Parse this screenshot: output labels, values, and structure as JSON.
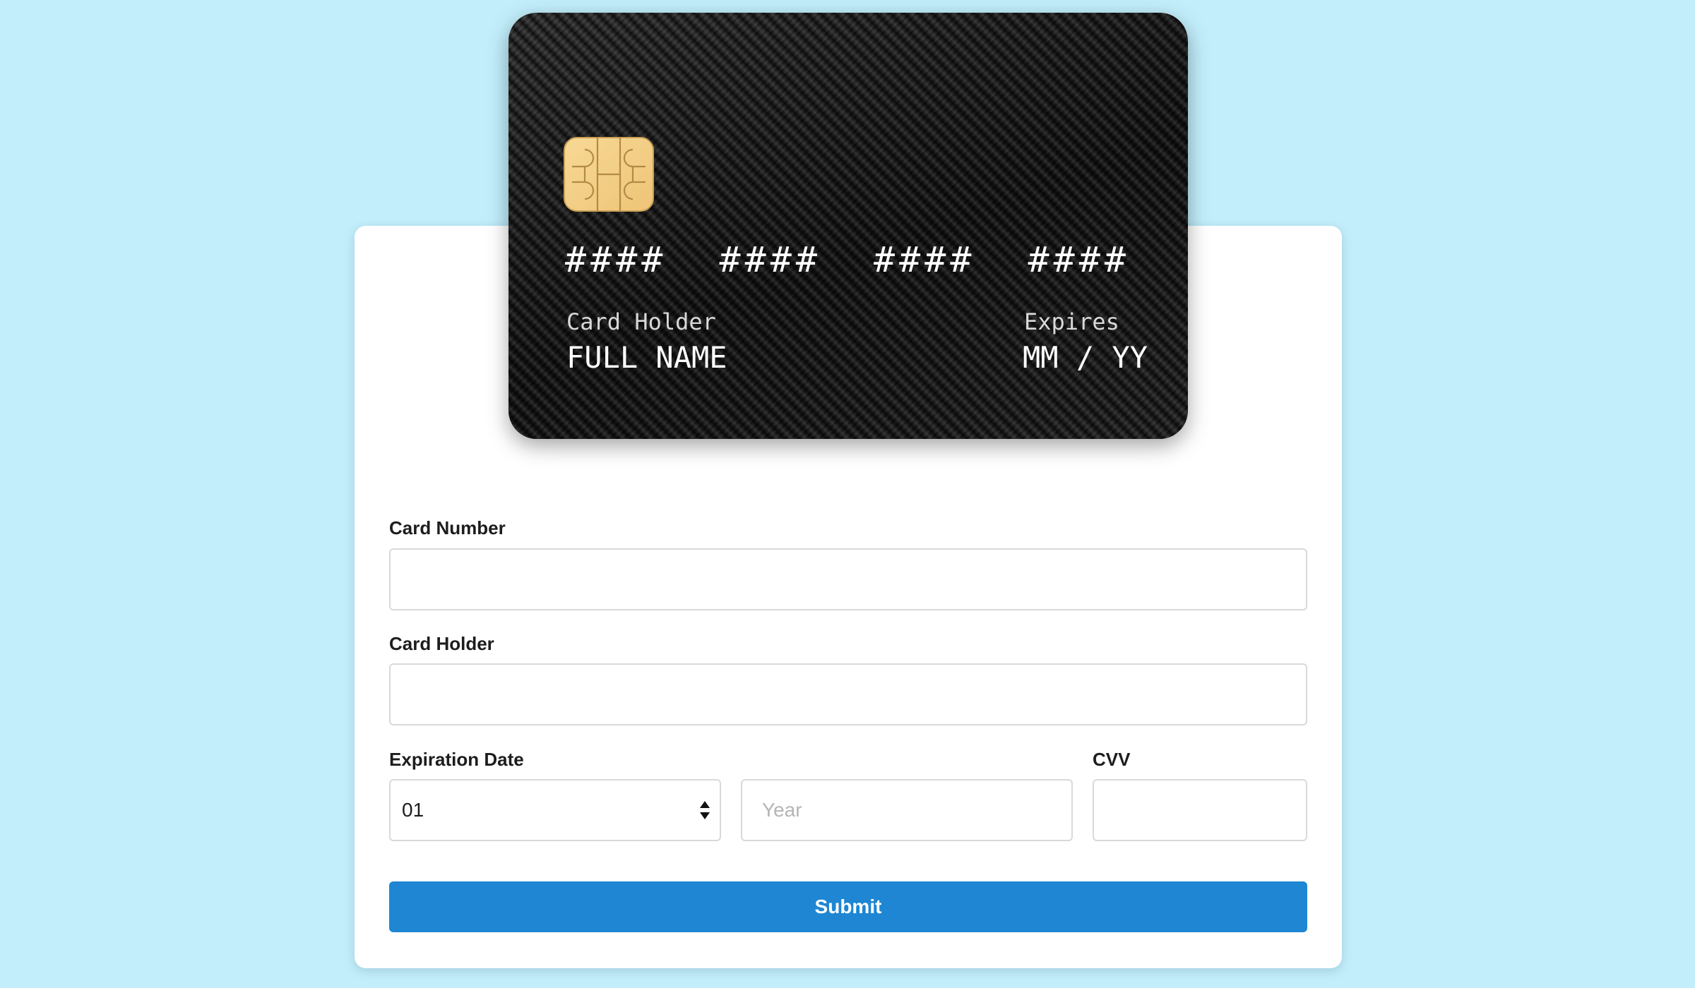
{
  "card_preview": {
    "number_groups": [
      "####",
      "####",
      "####",
      "####"
    ],
    "holder_caption": "Card Holder",
    "holder_value": "FULL NAME",
    "expires_caption": "Expires",
    "expires_value": "MM / YY"
  },
  "form": {
    "card_number": {
      "label": "Card Number",
      "value": "",
      "placeholder": ""
    },
    "card_holder": {
      "label": "Card Holder",
      "value": "",
      "placeholder": ""
    },
    "expiration": {
      "label": "Expiration Date",
      "month_selected": "01",
      "year_placeholder": "Year"
    },
    "cvv": {
      "label": "CVV",
      "value": "",
      "placeholder": ""
    },
    "submit_label": "Submit"
  },
  "colors": {
    "background": "#c2eefb",
    "accent": "#1e86d2",
    "chip": "#f3cd82"
  }
}
